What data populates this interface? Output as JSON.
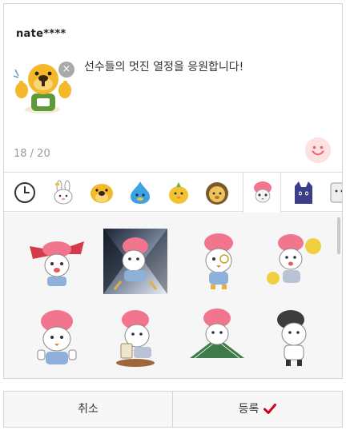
{
  "composer": {
    "username": "nate****",
    "message": "선수들의 멋진 열정을 응원합니다!",
    "counter": "18 / 20",
    "remove_symbol": "×"
  },
  "tabs": [
    {
      "name": "recent-clock-icon"
    },
    {
      "name": "rabbit-icon"
    },
    {
      "name": "dog-icon"
    },
    {
      "name": "blue-drop-icon"
    },
    {
      "name": "chick-icon"
    },
    {
      "name": "lion-icon"
    },
    {
      "name": "pink-hair-character-icon",
      "active": true
    },
    {
      "name": "purple-cat-icon"
    },
    {
      "name": "more-icon"
    }
  ],
  "stickers": [
    {
      "name": "sticker-ribbon"
    },
    {
      "name": "sticker-selected-dramatic",
      "selected": true
    },
    {
      "name": "sticker-monocle"
    },
    {
      "name": "sticker-cheerleader"
    },
    {
      "name": "sticker-thumbs-up"
    },
    {
      "name": "sticker-beer"
    },
    {
      "name": "sticker-fan"
    },
    {
      "name": "sticker-gray-hair"
    }
  ],
  "buttons": {
    "cancel": "취소",
    "submit": "등록"
  },
  "colors": {
    "accent_red": "#d0021b",
    "emoji_pink": "#fbe1e0",
    "hair_pink": "#f0758d",
    "border": "#d4d4d4"
  }
}
